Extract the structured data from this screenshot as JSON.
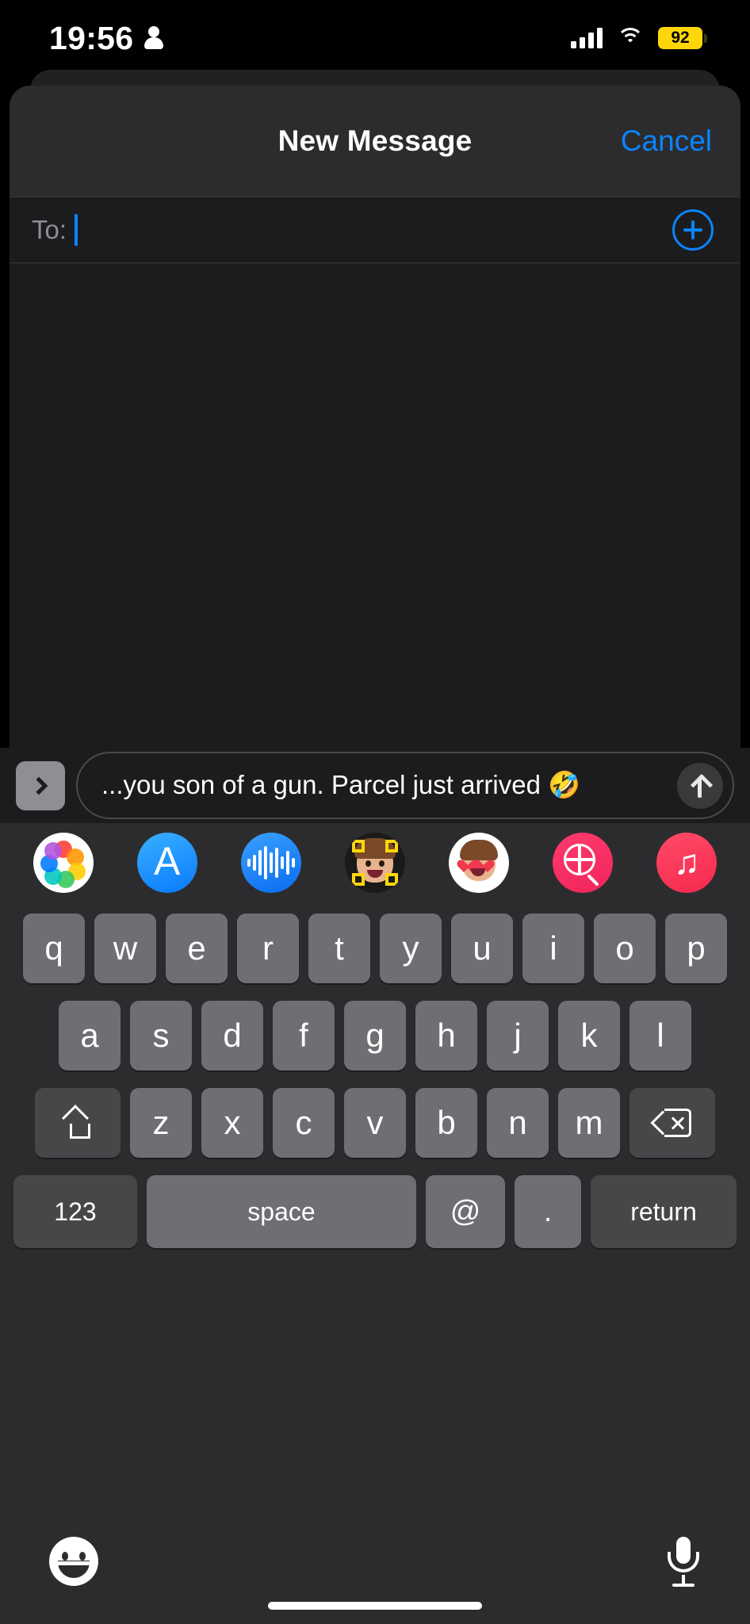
{
  "status_bar": {
    "time": "19:56",
    "person_icon": "person-icon",
    "signal_icon": "cellular-signal-icon",
    "wifi_icon": "wifi-icon",
    "battery_percent": "92",
    "battery_color": "#FFD60A"
  },
  "sheet": {
    "title": "New Message",
    "cancel_label": "Cancel",
    "accent_color": "#0A84FF"
  },
  "to_field": {
    "label": "To:",
    "value": "",
    "placeholder": "",
    "add_contact_icon": "plus-circle-icon"
  },
  "composer": {
    "expand_icon": "chevron-right-icon",
    "message_text": "...you son of a gun. Parcel just arrived 🤣",
    "send_icon": "arrow-up-icon"
  },
  "app_row": {
    "apps": [
      {
        "name": "photos",
        "icon": "photos-icon"
      },
      {
        "name": "app-store",
        "icon": "app-store-icon",
        "glyph": "A"
      },
      {
        "name": "audio-message",
        "icon": "audio-waveform-icon"
      },
      {
        "name": "memoji-camera",
        "icon": "memoji-camera-icon"
      },
      {
        "name": "memoji-stickers",
        "icon": "memoji-stickers-icon"
      },
      {
        "name": "images-search",
        "icon": "images-search-icon"
      },
      {
        "name": "apple-music",
        "icon": "music-note-icon",
        "glyph": "♫"
      }
    ]
  },
  "keyboard": {
    "row1": [
      "q",
      "w",
      "e",
      "r",
      "t",
      "y",
      "u",
      "i",
      "o",
      "p"
    ],
    "row2": [
      "a",
      "s",
      "d",
      "f",
      "g",
      "h",
      "j",
      "k",
      "l"
    ],
    "row3": [
      "z",
      "x",
      "c",
      "v",
      "b",
      "n",
      "m"
    ],
    "shift_icon": "shift-icon",
    "backspace_icon": "backspace-icon",
    "numbers_label": "123",
    "space_label": "space",
    "at_label": "@",
    "dot_label": ".",
    "return_label": "return"
  },
  "bottom_bar": {
    "emoji_icon": "emoji-smiley-icon",
    "dictation_icon": "microphone-icon"
  }
}
